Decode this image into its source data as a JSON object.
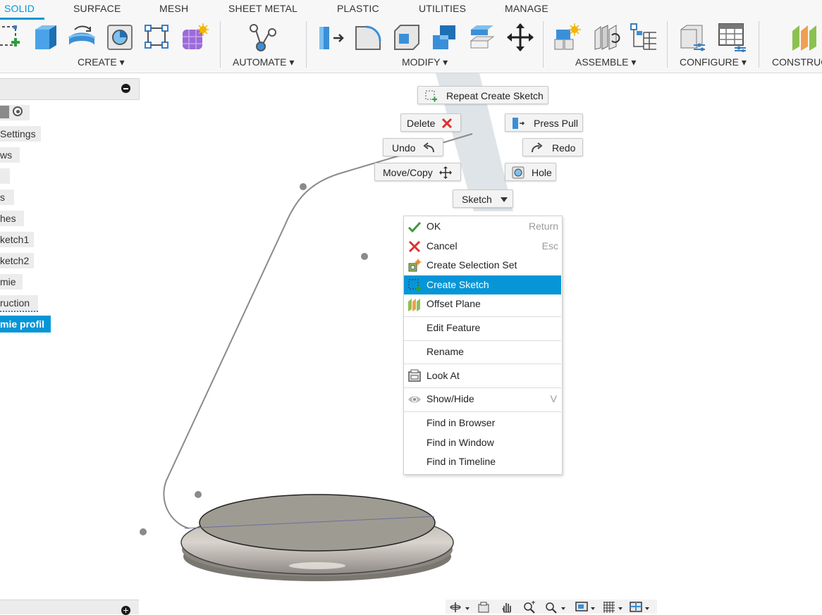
{
  "toolbar": {
    "tabs": [
      "SOLID",
      "SURFACE",
      "MESH",
      "SHEET METAL",
      "PLASTIC",
      "UTILITIES",
      "MANAGE"
    ],
    "active_tab": "SOLID",
    "groups": [
      "CREATE ▾",
      "AUTOMATE ▾",
      "MODIFY ▾",
      "ASSEMBLE ▾",
      "CONFIGURE ▾",
      "CONSTRUC"
    ],
    "accent": "#0696d7"
  },
  "browser": {
    "items": [
      "Settings",
      "ws",
      "",
      "s",
      "hes",
      "ketch1",
      "ketch2",
      "mie",
      "ruction",
      "mie profil"
    ],
    "selected_item": "mie profil"
  },
  "marking_menu": {
    "repeat": "Repeat Create Sketch",
    "delete": "Delete",
    "press_pull": "Press Pull",
    "undo": "Undo",
    "redo": "Redo",
    "move_copy": "Move/Copy",
    "hole": "Hole",
    "sketch": "Sketch"
  },
  "context_menu": {
    "ok": {
      "label": "OK",
      "shortcut": "Return"
    },
    "cancel": {
      "label": "Cancel",
      "shortcut": "Esc"
    },
    "create_selection_set": "Create Selection Set",
    "create_sketch": "Create Sketch",
    "offset_plane": "Offset Plane",
    "edit_feature": "Edit Feature",
    "rename": "Rename",
    "look_at": "Look At",
    "show_hide": {
      "label": "Show/Hide",
      "shortcut": "V"
    },
    "find_in_browser": "Find in Browser",
    "find_in_window": "Find in Window",
    "find_in_timeline": "Find in Timeline",
    "highlight_color": "#0696d7"
  },
  "icons": [
    "create-sketch-icon",
    "extrude-icon",
    "revolve-icon",
    "hole-icon",
    "pattern-icon",
    "form-icon",
    "automate-icon",
    "press-pull-icon",
    "fillet-icon",
    "shell-icon",
    "combine-icon",
    "align-icon",
    "move-icon",
    "new-component-icon",
    "joint-icon",
    "bill-of-materials-icon",
    "parameters-icon",
    "configure-table-icon",
    "offset-plane-icon",
    "delete-icon",
    "undo-icon",
    "redo-icon",
    "dropdown-arrow-icon",
    "orbit-icon",
    "look-at-icon",
    "pan-icon",
    "zoom-icon",
    "zoom-window-icon",
    "display-settings-icon",
    "grid-icon",
    "viewports-icon"
  ]
}
